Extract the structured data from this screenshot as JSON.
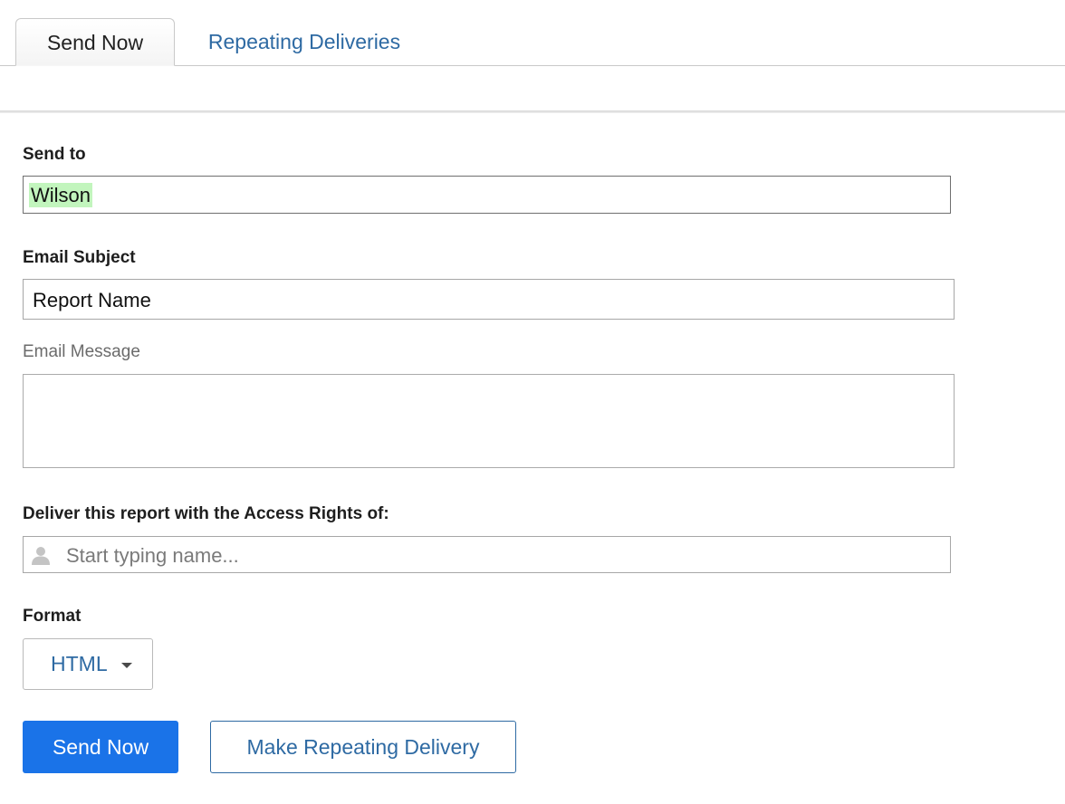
{
  "tabs": [
    {
      "label": "Send Now",
      "active": true
    },
    {
      "label": "Repeating Deliveries",
      "active": false
    }
  ],
  "form": {
    "send_to": {
      "label": "Send to",
      "value": "Wilson"
    },
    "email_subject": {
      "label": "Email Subject",
      "value": "Report Name"
    },
    "email_message": {
      "label": "Email Message",
      "value": ""
    },
    "access_rights": {
      "label": "Deliver this report with the Access Rights of:",
      "placeholder": "Start typing name...",
      "icon": "person-icon"
    },
    "format": {
      "label": "Format",
      "selected": "HTML"
    }
  },
  "actions": {
    "send_now": "Send Now",
    "make_repeating": "Make Repeating Delivery"
  },
  "colors": {
    "accent": "#1a73e8",
    "link": "#2e6aa3",
    "recipient_highlight": "#c2f5bd"
  }
}
